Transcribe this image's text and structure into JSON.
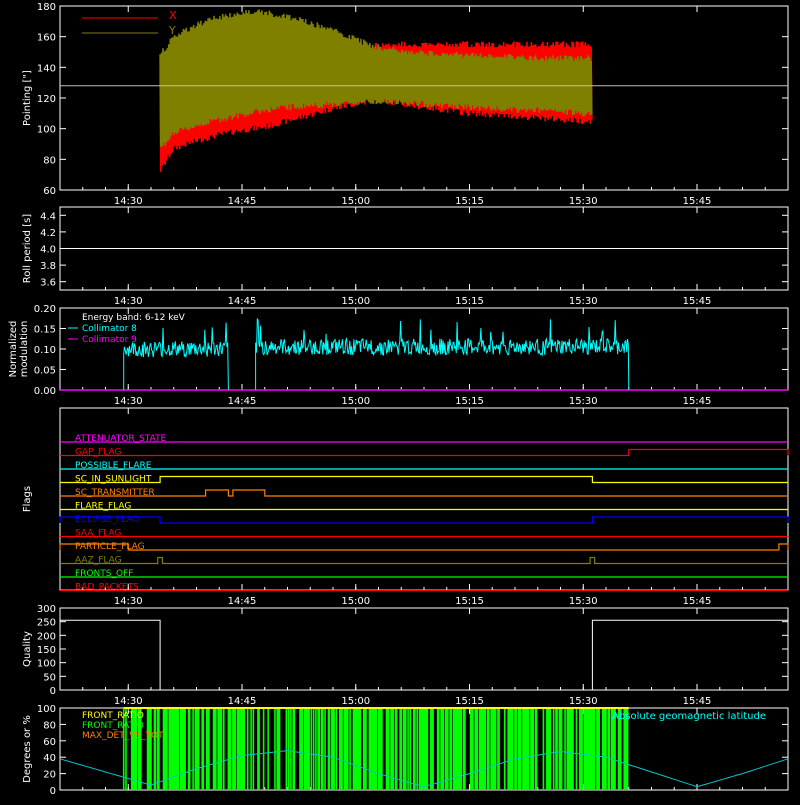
{
  "colors": {
    "background": "#000000",
    "axis": "#ffffff",
    "x_series": "#ff0000",
    "y_series": "#808000",
    "collimator8": "#00ffff",
    "collimator9": "#ff00ff",
    "front_ratio_a": "#ffff00",
    "front_ratio_b": "#00ff00",
    "max_det": "#ff8000",
    "latitude": "#00c8c8"
  },
  "time_axis": {
    "range_hours": [
      14.35,
      15.95
    ],
    "tick_labels": [
      "14:30",
      "14:45",
      "15:00",
      "15:15",
      "15:30",
      "15:45"
    ],
    "tick_hours": [
      14.5,
      14.75,
      15.0,
      15.25,
      15.5,
      15.75
    ]
  },
  "chart_data": [
    {
      "id": "pointing",
      "type": "line",
      "ylabel": "Pointing [\"]",
      "ylim": [
        60,
        180
      ],
      "yticks": [
        "60",
        "80",
        "100",
        "120",
        "140",
        "160",
        "180"
      ],
      "reference_y": 128,
      "legend": [
        {
          "name": "X",
          "color": "#ff0000"
        },
        {
          "name": "Y",
          "color": "#808000"
        }
      ],
      "series": [
        {
          "name": "X",
          "color": "#ff0000",
          "x_hours": [
            14.57,
            14.6,
            14.65,
            14.7,
            14.75,
            14.8,
            14.85,
            14.9,
            14.95,
            15.0,
            15.05,
            15.1,
            15.15,
            15.2,
            15.25,
            15.3,
            15.35,
            15.4,
            15.45,
            15.5,
            15.52
          ],
          "upper": [
            140,
            150,
            158,
            163,
            166,
            167,
            166,
            164,
            161,
            158,
            156,
            157,
            157,
            157,
            157,
            157,
            157,
            157,
            157,
            157,
            157
          ],
          "lower": [
            70,
            85,
            90,
            94,
            97,
            99,
            103,
            107,
            111,
            114,
            117,
            114,
            112,
            110,
            108,
            107,
            106,
            105,
            104,
            103,
            103
          ]
        },
        {
          "name": "Y",
          "color": "#808000",
          "x_hours": [
            14.57,
            14.6,
            14.65,
            14.7,
            14.75,
            14.8,
            14.85,
            14.9,
            14.95,
            15.0,
            15.05,
            15.1,
            15.15,
            15.2,
            15.25,
            15.3,
            15.35,
            15.4,
            15.45,
            15.5,
            15.52
          ],
          "upper": [
            150,
            162,
            170,
            175,
            178,
            178,
            175,
            171,
            166,
            160,
            155,
            153,
            151,
            150,
            150,
            149,
            149,
            148,
            148,
            148,
            148
          ],
          "lower": [
            85,
            95,
            100,
            104,
            107,
            110,
            112,
            113,
            114,
            115,
            116,
            115,
            114,
            113,
            112,
            111,
            110,
            110,
            109,
            108,
            108
          ]
        }
      ]
    },
    {
      "id": "roll",
      "type": "line",
      "ylabel": "Roll period [s]",
      "ylim": [
        3.5,
        4.5
      ],
      "yticks": [
        "3.6",
        "3.8",
        "4.0",
        "4.2",
        "4.4"
      ],
      "ytick_values": [
        3.6,
        3.8,
        4.0,
        4.2,
        4.4
      ],
      "series": [
        {
          "name": "",
          "x_hours": [
            14.35,
            15.95
          ],
          "values": [
            4.0,
            4.0
          ]
        }
      ]
    },
    {
      "id": "modulation",
      "type": "line",
      "ylabel": "Normalized modulation",
      "ylim": [
        0,
        0.2
      ],
      "yticks": [
        "0.00",
        "0.05",
        "0.10",
        "0.15",
        "0.20"
      ],
      "ytick_values": [
        0,
        0.05,
        0.1,
        0.15,
        0.2
      ],
      "legend": [
        {
          "name": "Energy band: 6-12 keV",
          "color": "#ffffff"
        },
        {
          "name": "Collimator 8",
          "color": "#00ffff"
        },
        {
          "name": "Collimator 9",
          "color": "#ff00ff"
        }
      ],
      "series": [
        {
          "name": "Collimator 8",
          "color": "#00ffff",
          "segments": [
            [
              14.49,
              14.72,
              0.1
            ],
            [
              14.78,
              15.6,
              0.105
            ]
          ]
        },
        {
          "name": "Collimator 9",
          "color": "#ff00ff",
          "values": [
            0,
            0
          ]
        }
      ]
    },
    {
      "id": "flags",
      "type": "line",
      "ylabel": "Flags",
      "flags": [
        {
          "name": "ATTENUATOR_STATE",
          "color": "#ff00ff",
          "low": [],
          "high_segments": []
        },
        {
          "name": "GAP_FLAG",
          "color": "#ff0000",
          "high_segments": [
            [
              15.6,
              15.95
            ]
          ]
        },
        {
          "name": "POSSIBLE_FLARE",
          "color": "#00ffff",
          "high_segments": []
        },
        {
          "name": "SC_IN_SUNLIGHT",
          "color": "#ffff00",
          "high_segments": [
            [
              14.57,
              15.52
            ]
          ]
        },
        {
          "name": "SC_TRANSMITTER",
          "color": "#ff8000",
          "high_segments": [
            [
              14.67,
              14.72
            ],
            [
              14.73,
              14.8
            ]
          ]
        },
        {
          "name": "FLARE_FLAG",
          "color": "#ffff00",
          "high_segments": []
        },
        {
          "name": "ECLIPSE_FLAG",
          "color": "#0000ff",
          "high_segments": [
            [
              14.35,
              14.57
            ],
            [
              15.52,
              15.95
            ]
          ]
        },
        {
          "name": "SAA_FLAG",
          "color": "#ff0000",
          "high_segments": []
        },
        {
          "name": "PARTICLE_FLAG",
          "color": "#ff8000",
          "high_segments": [
            [
              14.35,
              14.5
            ],
            [
              15.93,
              15.95
            ]
          ]
        },
        {
          "name": "AAZ_FLAG",
          "color": "#808000",
          "high_segments": [
            [
              14.565,
              14.575
            ],
            [
              15.515,
              15.525
            ]
          ]
        },
        {
          "name": "FRONTS_OFF",
          "color": "#00ff00",
          "high_segments": []
        },
        {
          "name": "BAD_PACKETS",
          "color": "#ff0000",
          "high_segments": []
        }
      ]
    },
    {
      "id": "quality",
      "type": "line",
      "ylabel": "Quality",
      "ylim": [
        0,
        300
      ],
      "yticks": [
        "0",
        "50",
        "100",
        "150",
        "200",
        "250",
        "300"
      ],
      "ytick_values": [
        0,
        50,
        100,
        150,
        200,
        250,
        300
      ],
      "series": [
        {
          "name": "",
          "x_hours": [
            14.35,
            14.57,
            14.57,
            15.52,
            15.52,
            15.95
          ],
          "values": [
            255,
            255,
            0,
            0,
            255,
            255
          ]
        }
      ]
    },
    {
      "id": "latitude",
      "type": "line",
      "ylabel": "Degrees or %",
      "ylim": [
        0,
        100
      ],
      "yticks": [
        "0",
        "20",
        "40",
        "60",
        "80",
        "100"
      ],
      "ytick_values": [
        0,
        20,
        40,
        60,
        80,
        100
      ],
      "legend": [
        {
          "name": "FRONT_RATIO",
          "color": "#ffff00"
        },
        {
          "name": "FRONT_RATIO",
          "color": "#00ff00"
        },
        {
          "name": "MAX_DET_VS_TOT",
          "color": "#ff8000"
        }
      ],
      "right_legend": {
        "name": "Absolute geomagnetic latitude",
        "color": "#00ffff"
      },
      "series": [
        {
          "name": "Absolute geomagnetic latitude",
          "color": "#00c8c8",
          "x_hours": [
            14.35,
            14.45,
            14.55,
            14.65,
            14.75,
            14.85,
            14.95,
            15.05,
            15.15,
            15.25,
            15.35,
            15.45,
            15.55,
            15.65,
            15.75,
            15.85,
            15.95
          ],
          "values": [
            38,
            22,
            6,
            26,
            42,
            48,
            40,
            20,
            4,
            20,
            38,
            47,
            40,
            22,
            4,
            20,
            38
          ]
        },
        {
          "name": "FRONT_RATIO",
          "color": "#00ff00",
          "span": [
            14.49,
            15.6
          ],
          "values": [
            100,
            0
          ]
        }
      ]
    }
  ]
}
